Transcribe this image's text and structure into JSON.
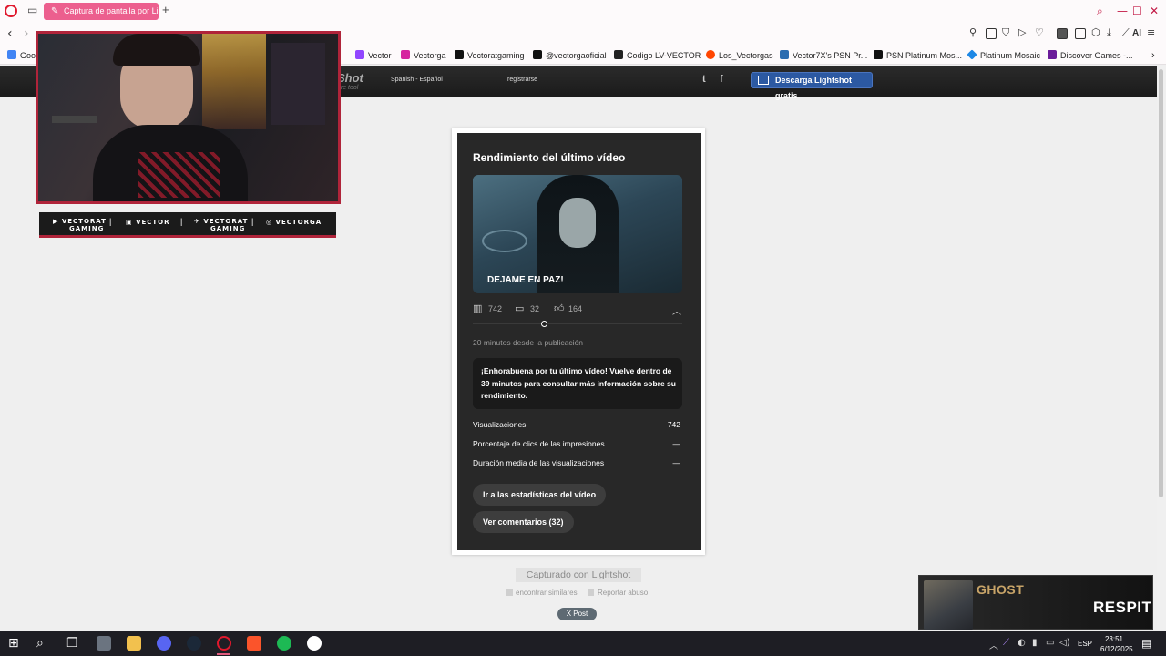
{
  "browser": {
    "active_tab_title": "Captura de pantalla por Lightshot",
    "new_tab_glyph": "+",
    "toolbar_ai_label": "AI",
    "accent_color": "#ec5f8e"
  },
  "bookmarks": [
    {
      "label": "Goog",
      "icon": "google-icon",
      "color": "#4285f4"
    },
    {
      "label": "Vector",
      "icon": "twitch-icon",
      "color": "#9146ff"
    },
    {
      "label": "Vectorga",
      "icon": "instagram-icon",
      "color": "#d6249f"
    },
    {
      "label": "Vectoratgaming",
      "icon": "x-icon",
      "color": "#111111"
    },
    {
      "label": "@vectorgaoficial",
      "icon": "tiktok-icon",
      "color": "#111111"
    },
    {
      "label": "Codigo LV-VECTOR",
      "icon": "bookmark-icon",
      "color": "#222222"
    },
    {
      "label": "Los_Vectorgas",
      "icon": "reddit-icon",
      "color": "#ff4500"
    },
    {
      "label": "Vector7X's PSN Pr...",
      "icon": "psn-icon",
      "color": "#2b6cb0"
    },
    {
      "label": "PSN Platinum Mos...",
      "icon": "psn-icon",
      "color": "#111111"
    },
    {
      "label": "Platinum Mosaic",
      "icon": "diamond-icon",
      "color": "#1e88e5"
    },
    {
      "label": "Discover Games -...",
      "icon": "games-icon",
      "color": "#6a1b9a"
    }
  ],
  "lightshot": {
    "logo": "Shot",
    "logo_sub": "ure tool",
    "language": "Spanish - Español",
    "register": "registrarse",
    "twitter_glyph": "t",
    "facebook_glyph": "f",
    "download_label": "Descarga Lightshot gratis",
    "captured_label": "Capturado con Lightshot",
    "find_similar": "encontrar similares",
    "report_abuse": "Reportar abuso",
    "x_post": "X Post"
  },
  "webcam": {
    "socials": [
      {
        "icon": "youtube-icon",
        "line1": "VECTORAT",
        "line2": "GAMING"
      },
      {
        "icon": "twitch-icon",
        "line1": "VECTOR",
        "line2": ""
      },
      {
        "icon": "twitter-icon",
        "line1": "VECTORAT",
        "line2": "GAMING"
      },
      {
        "icon": "instagram-icon",
        "line1": "VECTORGA",
        "line2": ""
      }
    ]
  },
  "card": {
    "title": "Rendimiento del último vídeo",
    "thumbnail_caption": "DEJAME EN PAZ!",
    "views": "742",
    "comments": "32",
    "likes": "164",
    "time_since": "20 minutos desde la publicación",
    "congrats": "¡Enhorabuena por tu último vídeo! Vuelve dentro de 39 minutos para consultar más información sobre su rendimiento.",
    "metrics": [
      {
        "label": "Visualizaciones",
        "value": "742"
      },
      {
        "label": "Porcentaje de clics de las impresiones",
        "value": "—"
      },
      {
        "label": "Duración media de las visualizaciones",
        "value": "—"
      }
    ],
    "btn_stats": "Ir a las estadísticas del vídeo",
    "btn_comments": "Ver comentarios (32)"
  },
  "game_overlay": {
    "title": "GHOST",
    "subtitle": "RESPIT"
  },
  "taskbar": {
    "language": "ESP",
    "time": "23:51",
    "date": "6/12/2025"
  }
}
